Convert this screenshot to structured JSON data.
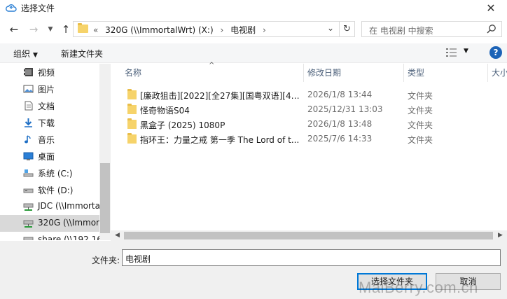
{
  "window": {
    "title": "选择文件"
  },
  "address": {
    "crumbs": [
      "«",
      "320G (\\\\ImmortalWrt) (X:)",
      "›",
      "电视剧",
      "›"
    ]
  },
  "search": {
    "placeholder": "在 电视剧 中搜索"
  },
  "commands": {
    "organize": "组织",
    "new_folder": "新建文件夹"
  },
  "nav": {
    "items": [
      {
        "label": "视频",
        "icon": "video-library-icon"
      },
      {
        "label": "图片",
        "icon": "pictures-icon"
      },
      {
        "label": "文档",
        "icon": "documents-icon"
      },
      {
        "label": "下载",
        "icon": "downloads-icon"
      },
      {
        "label": "音乐",
        "icon": "music-icon"
      },
      {
        "label": "桌面",
        "icon": "desktop-icon"
      },
      {
        "label": "系统 (C:)",
        "icon": "system-drive-icon"
      },
      {
        "label": "软件 (D:)",
        "icon": "drive-icon"
      },
      {
        "label": "JDC (\\\\Immorta",
        "icon": "network-drive-icon"
      },
      {
        "label": "320G (\\\\Immor",
        "icon": "network-drive-icon"
      },
      {
        "label": "share (\\\\192.16",
        "icon": "network-drive-icon"
      }
    ]
  },
  "columns": {
    "name": "名称",
    "modified": "修改日期",
    "type": "类型",
    "size": "大小"
  },
  "files": [
    {
      "name": "[廉政狙击][2022][全27集][国粤双语][4K ...",
      "modified": "2026/1/8 13:44",
      "type": "文件夹"
    },
    {
      "name": "怪奇物语S04",
      "modified": "2025/12/31 13:03",
      "type": "文件夹"
    },
    {
      "name": "黑盒子 (2025) 1080P",
      "modified": "2026/1/8 13:48",
      "type": "文件夹"
    },
    {
      "name": "指环王：力量之戒 第一季 The Lord of t...",
      "modified": "2025/7/6 14:33",
      "type": "文件夹"
    }
  ],
  "footer": {
    "filename_label": "文件夹:",
    "filename_value": "电视剧",
    "select_button": "选择文件夹",
    "cancel_button": "取消",
    "watermark": "MaiBerry.com.cn"
  },
  "colors": {
    "accent": "#0078d7",
    "folder": "#f6d36a",
    "help": "#1c63b7"
  }
}
